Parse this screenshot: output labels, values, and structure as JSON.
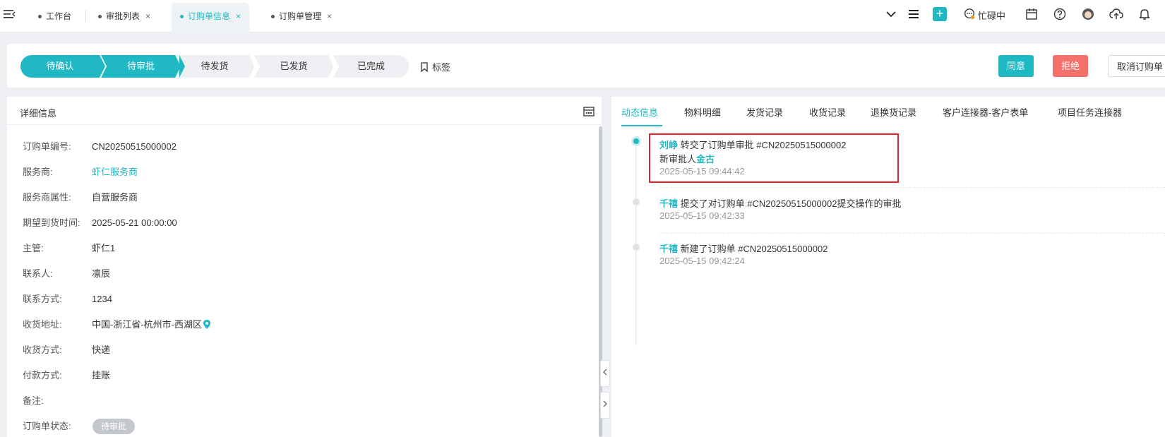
{
  "topbar": {
    "tabs": [
      {
        "label": "工作台",
        "closable": false,
        "active": false
      },
      {
        "label": "审批列表",
        "closable": true,
        "active": false
      },
      {
        "label": "订购单信息",
        "closable": true,
        "active": true
      },
      {
        "label": "订购单管理",
        "closable": true,
        "active": false
      }
    ],
    "close_glyph": "×",
    "busy_status": "忙碌中",
    "icons": [
      "menu-toggle-icon",
      "chevron-down-icon",
      "list-icon",
      "plus-icon",
      "chat-status-icon",
      "calendar-icon",
      "help-icon",
      "avatar-icon",
      "cloud-upload-icon",
      "bell-icon"
    ]
  },
  "status": {
    "steps": [
      {
        "label": "待确认",
        "done": true
      },
      {
        "label": "待审批",
        "done": true
      },
      {
        "label": "待发货",
        "done": false
      },
      {
        "label": "已发货",
        "done": false
      },
      {
        "label": "已完成",
        "done": false
      }
    ],
    "tag_label": "标签",
    "agree_label": "同意",
    "reject_label": "拒绝",
    "cancel_label": "取消订购单"
  },
  "detail": {
    "title": "详细信息",
    "fields": [
      {
        "label": "订购单编号:",
        "value": "CN20250515000002"
      },
      {
        "label": "服务商:",
        "value": "虾仁服务商"
      },
      {
        "label": "服务商属性:",
        "value": "自营服务商"
      },
      {
        "label": "期望到货时间:",
        "value": "2025-05-21 00:00:00"
      },
      {
        "label": "主管:",
        "value": "虾仁1"
      },
      {
        "label": "联系人:",
        "value": "凛辰"
      },
      {
        "label": "联系方式:",
        "value": "1234"
      },
      {
        "label": "收货地址:",
        "value": "中国-浙江省-杭州市-西湖区"
      },
      {
        "label": "收货方式:",
        "value": "快递"
      },
      {
        "label": "付款方式:",
        "value": "挂账"
      },
      {
        "label": "备注:",
        "value": ""
      },
      {
        "label": "订购单状态:",
        "value": "待审批"
      }
    ]
  },
  "right": {
    "tabs": [
      "动态信息",
      "物料明细",
      "发货记录",
      "收货记录",
      "退换货记录",
      "客户连接器-客户表单",
      "项目任务连接器"
    ],
    "timeline": [
      {
        "actor": "刘峥",
        "text": "转交了订购单审批 #CN20250515000002",
        "extra_prefix": "新审批人",
        "extra_actor": "金古",
        "time": "2025-05-15 09:44:42"
      },
      {
        "actor": "千禧",
        "text": "提交了对订购单 #CN20250515000002提交操作的审批",
        "time": "2025-05-15 09:42:33"
      },
      {
        "actor": "千禧",
        "text": "新建了订购单 #CN20250515000002",
        "time": "2025-05-15 09:42:24"
      }
    ]
  },
  "colors": {
    "accent": "#1fb8c3",
    "reject": "#f4706b",
    "highlight": "#e5252a"
  }
}
